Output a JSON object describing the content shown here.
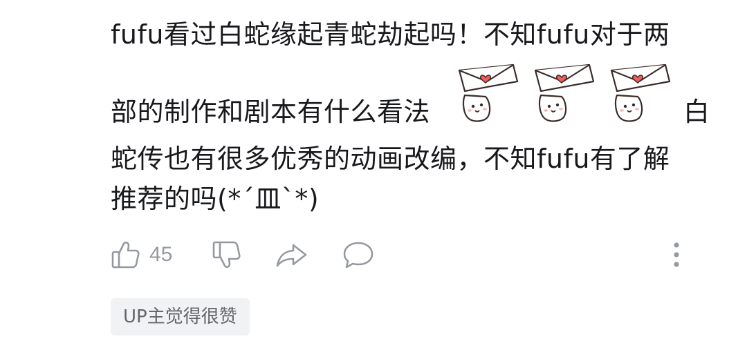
{
  "comment": {
    "line1": "fufu看过白蛇缘起青蛇劫起吗！不知fufu对于两",
    "line2": "部的制作和剧本有什么看法",
    "line2_end": "白",
    "line3": "蛇传也有很多优秀的动画改编，不知fufu有了解",
    "line4": "推荐的吗(*´皿`*)",
    "stickers": [
      "love-letter-sticker",
      "love-letter-sticker",
      "love-letter-sticker"
    ]
  },
  "actions": {
    "like_count": "45",
    "icons": [
      "thumb-up-icon",
      "thumb-down-icon",
      "share-icon",
      "reply-icon",
      "more-icon"
    ]
  },
  "badge": {
    "label": "UP主觉得很赞"
  },
  "colors": {
    "text": "#18191c",
    "icon": "#9499a0",
    "badge_bg": "#f1f2f3",
    "badge_text": "#61666d",
    "heart": "#f25d5d"
  }
}
